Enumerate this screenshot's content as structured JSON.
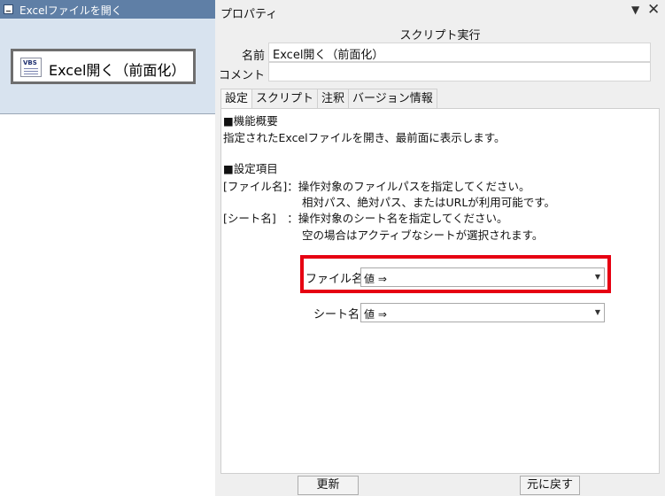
{
  "left_panel": {
    "title": "Excelファイルを開く",
    "node": {
      "label": "Excel開く（前面化）",
      "icon": "vbs-script-icon",
      "icon_text": "VBS"
    }
  },
  "properties": {
    "title": "プロパティ",
    "script_header": "スクリプト実行",
    "name_label": "名前",
    "name_value": "Excel開く（前面化）",
    "comment_label": "コメント",
    "comment_value": "",
    "tabs": [
      {
        "label": "設定",
        "active": true
      },
      {
        "label": "スクリプト"
      },
      {
        "label": "注釈"
      },
      {
        "label": "バージョン情報"
      }
    ],
    "description": {
      "line1": "■機能概要",
      "line2": "指定されたExcelファイルを開き、最前面に表示します。",
      "line3": "■設定項目",
      "line4": "[ファイル名]：操作対象のファイルパスを指定してください。",
      "line5": "相対パス、絶対パス、またはURLが利用可能です。",
      "line6": "[シート名]　：操作対象のシート名を指定してください。",
      "line7": "空の場合はアクティブなシートが選択されます。"
    },
    "settings": {
      "file_label": "ファイル名",
      "file_value": "値 ⇒",
      "sheet_label": "シート名",
      "sheet_value": "値 ⇒"
    },
    "buttons": {
      "update": "更新",
      "revert": "元に戻す"
    },
    "highlight_color": "#e60012"
  }
}
